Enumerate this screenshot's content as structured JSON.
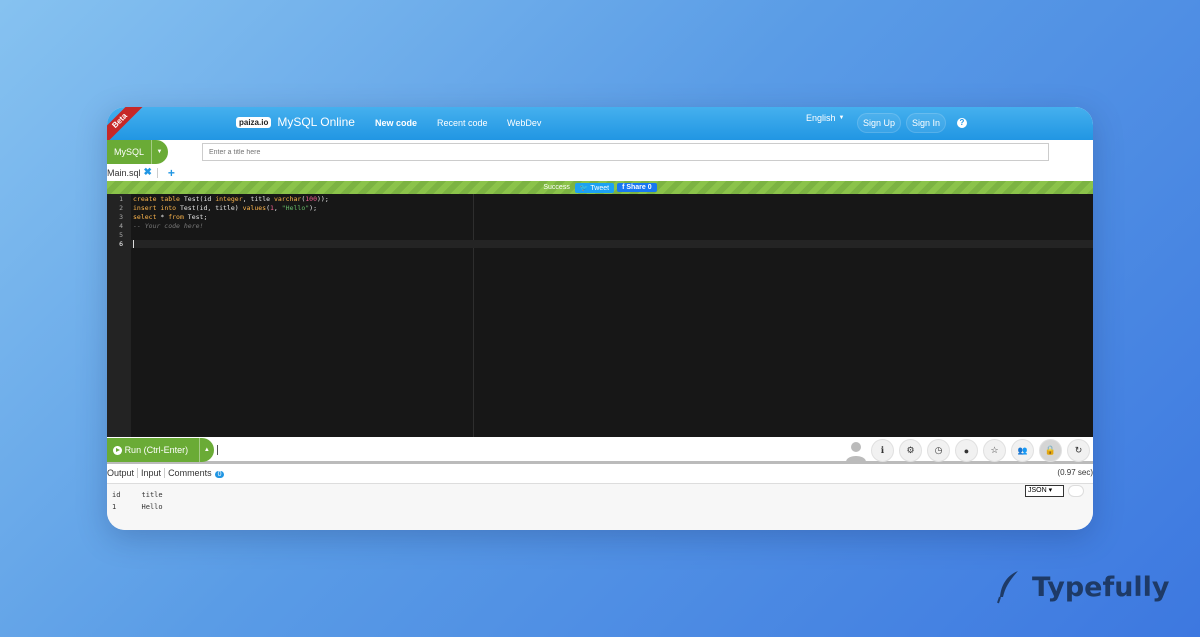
{
  "header": {
    "beta": "Beta",
    "logo_text": "paiza.io",
    "app_title": "MySQL Online",
    "nav": [
      "New code",
      "Recent code",
      "WebDev"
    ],
    "language": "English",
    "sign_up": "Sign Up",
    "sign_in": "Sign In"
  },
  "toolbar": {
    "language_label": "MySQL",
    "title_placeholder": "Enter a title here"
  },
  "tabs": {
    "file": "Main.sql"
  },
  "status": {
    "text": "Success",
    "tweet": "Tweet",
    "share": "Share 0"
  },
  "editor": {
    "line_numbers": [
      "1",
      "2",
      "3",
      "4",
      "5",
      "6"
    ],
    "code": [
      "create table Test(id integer, title varchar(100));",
      "insert into Test(id, title) values(1, \"Hello\");",
      "select * from Test;",
      "-- Your code here!",
      "",
      ""
    ]
  },
  "run": {
    "label": "Run (Ctrl-Enter)"
  },
  "tool_icons": [
    "info-icon",
    "settings-icon",
    "history-icon",
    "github-icon",
    "star-icon",
    "group-icon",
    "lock-icon",
    "refresh-icon"
  ],
  "output": {
    "tabs": [
      "Output",
      "Input",
      "Comments"
    ],
    "comments_count": "0",
    "time": "(0.97 sec)",
    "format": "JSON",
    "rows": [
      [
        "id",
        "title"
      ],
      [
        "1",
        "Hello"
      ]
    ]
  },
  "watermark": {
    "brand": "Typefully"
  },
  "colors": {
    "header": "#2196e3",
    "run_green": "#6aab36",
    "editor_bg": "#171717"
  }
}
